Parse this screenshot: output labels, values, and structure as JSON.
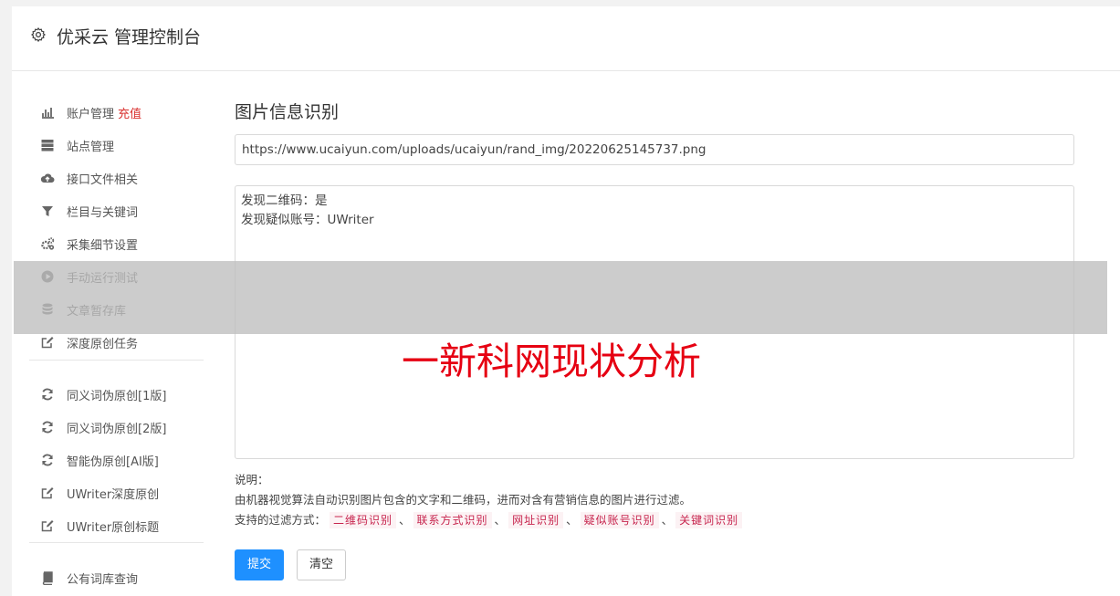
{
  "header": {
    "title": "优采云 管理控制台",
    "icon": "gear-icon"
  },
  "sidebar": {
    "groups": [
      [
        {
          "label": "账户管理",
          "badge": "充值",
          "icon": "bar-chart-icon"
        },
        {
          "label": "站点管理",
          "icon": "server-icon"
        },
        {
          "label": "接口文件相关",
          "icon": "cloud-upload-icon"
        },
        {
          "label": "栏目与关键词",
          "icon": "filter-icon"
        },
        {
          "label": "采集细节设置",
          "icon": "cogs-icon"
        },
        {
          "label": "手动运行测试",
          "icon": "play-circle-icon"
        },
        {
          "label": "文章暂存库",
          "icon": "database-icon"
        },
        {
          "label": "深度原创任务",
          "icon": "edit-icon"
        }
      ],
      [
        {
          "label": "同义词伪原创[1版]",
          "icon": "refresh-icon"
        },
        {
          "label": "同义词伪原创[2版]",
          "icon": "refresh-icon"
        },
        {
          "label": "智能伪原创[AI版]",
          "icon": "refresh-icon"
        },
        {
          "label": "UWriter深度原创",
          "icon": "edit-icon"
        },
        {
          "label": "UWriter原创标题",
          "icon": "edit-icon"
        }
      ],
      [
        {
          "label": "公有词库查询",
          "icon": "book-icon"
        }
      ]
    ]
  },
  "main": {
    "title": "图片信息识别",
    "url_value": "https://www.ucaiyun.com/uploads/ucaiyun/rand_img/20220625145737.png",
    "result_lines": [
      "发现二维码：是",
      "发现疑似账号：UWriter"
    ],
    "note": {
      "heading": "说明：",
      "description": "由机器视觉算法自动识别图片包含的文字和二维码，进而对含有营销信息的图片进行过滤。",
      "filters_label": "支持的过滤方式：",
      "filters": [
        "二维码识别",
        "联系方式识别",
        "网址识别",
        "疑似账号识别",
        "关键词识别"
      ],
      "separator": "、"
    },
    "submit_label": "提交",
    "clear_label": "清空"
  },
  "overlay": {
    "text": "一新科网现状分析",
    "color": "#e60012"
  },
  "colors": {
    "accent": "#1e90ff",
    "recharge": "#d9302e",
    "tag_text": "#c7254e",
    "tag_bg": "#fcf2f4"
  }
}
